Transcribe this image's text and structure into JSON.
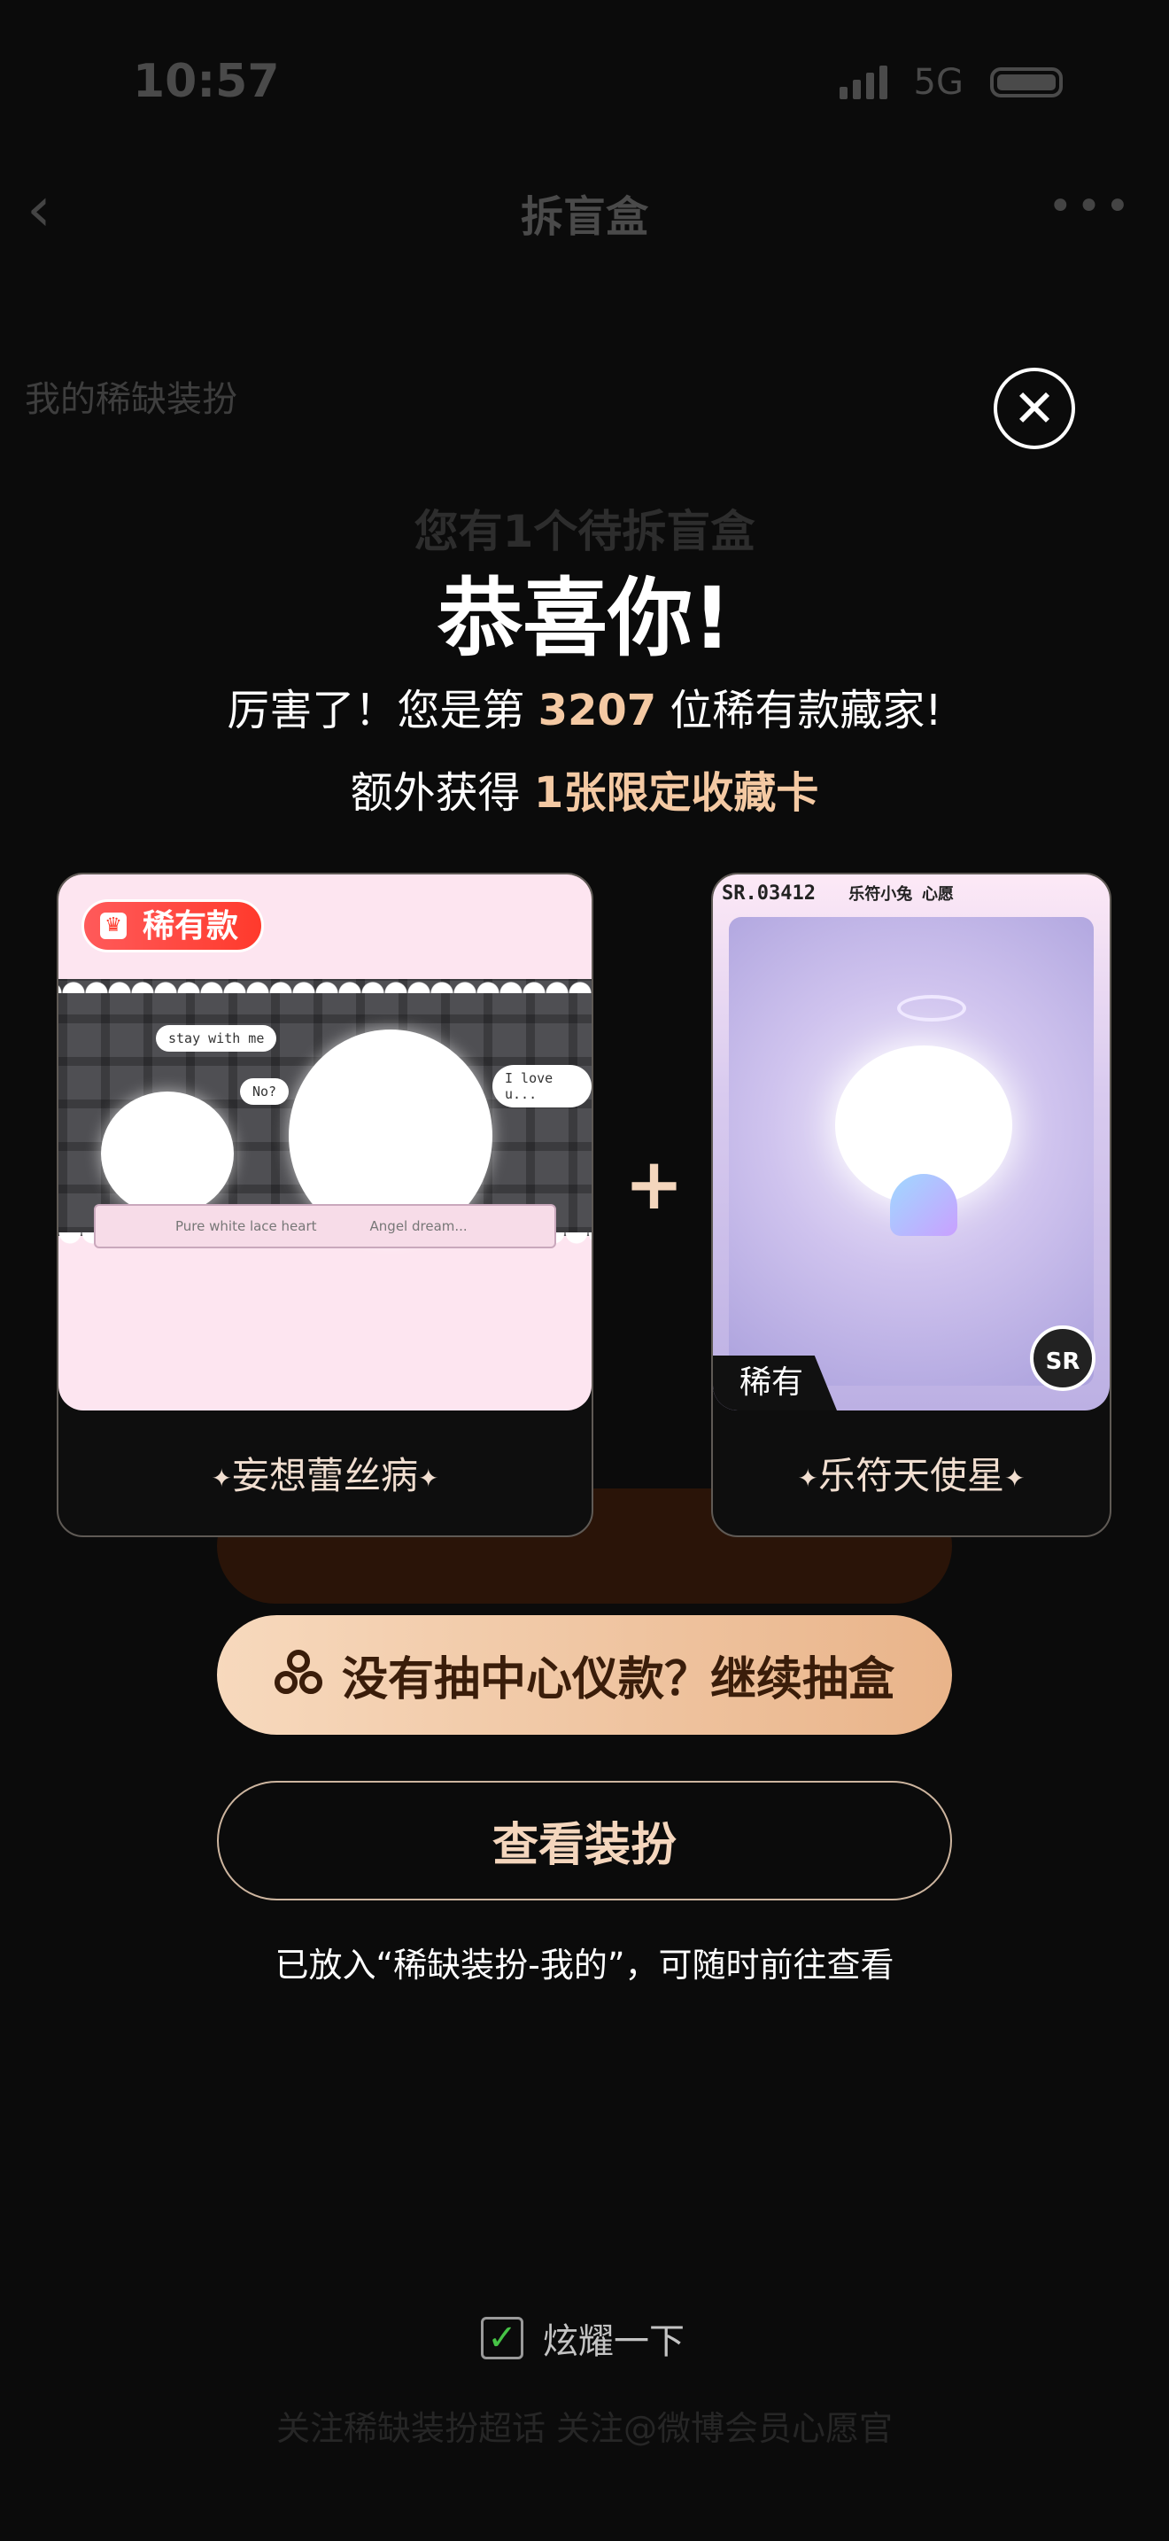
{
  "status_bar": {
    "time": "10:57",
    "network": "5G"
  },
  "nav": {
    "title": "拆盲盒",
    "more": "•••"
  },
  "background": {
    "tab_label": "我的稀缺装扮",
    "pending_text": "您有1个待拆盲盒",
    "footer_text": "关注稀缺装扮超话    关注@微博会员心愿官"
  },
  "modal": {
    "title": "恭喜你!",
    "line1_prefix": "厉害了！您是第 ",
    "collector_number": "3207",
    "line1_suffix": " 位稀有款藏家!",
    "line2_prefix": "额外获得 ",
    "line2_highlight": "1张限定收藏卡",
    "plus": "+",
    "cards": [
      {
        "badge": "稀有款",
        "name": "妄想蕾丝病",
        "art_texts": [
          "stay with me",
          "No?",
          "I love u...",
          "Pure white lace heart",
          "Angel dream..."
        ]
      },
      {
        "header_code": "SR.03412",
        "header_title": "乐符小兔 心愿",
        "rarity_tag": "稀有",
        "seal": "SR",
        "name": "乐符天使星"
      }
    ],
    "draw_again_label": "没有抽中心仪款？继续抽盒",
    "view_label": "查看装扮",
    "note": "已放入“稀缺装扮-我的”，可随时前往查看",
    "share_label": "炫耀一下",
    "share_checked": true
  },
  "colors": {
    "accent": "#f4c9a3",
    "button_gradient_start": "#f7d9bd",
    "button_gradient_end": "#e9b48a",
    "rare_badge": "#ff4a3a"
  }
}
